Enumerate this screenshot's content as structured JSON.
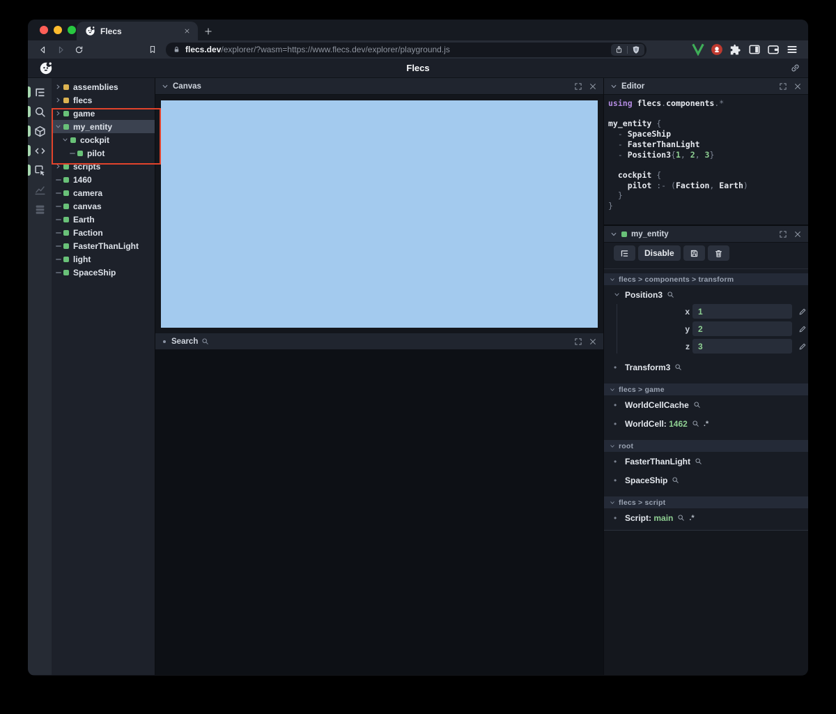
{
  "colors": {
    "accent_green": "#69c178",
    "accent_yellow": "#dcb351",
    "value_green": "#8ecf92",
    "code_keyword": "#b18adf",
    "canvas_blue": "#a3caee",
    "annotation_red": "#e2432b",
    "selection_gray": "#3b4250"
  },
  "browser": {
    "traffic_lights": [
      "close",
      "minimize",
      "zoom"
    ],
    "tab": {
      "title": "Flecs",
      "favicon": "flecs-logo",
      "close_icon": "close-icon"
    },
    "newtab_icon": "plus-icon",
    "nav": [
      "back-icon",
      "forward-icon",
      "reload-icon"
    ],
    "bookmark_icon": "bookmark-icon",
    "url": {
      "lock_icon": "lock-icon",
      "host": "flecs.dev",
      "path": "/explorer/?wasm=https://www.flecs.dev/explorer/playground.js",
      "share_icon": "share-icon",
      "shield_icon": "brave-shield-icon"
    },
    "extensions": [
      "v-extension-icon",
      "adblock-extension-icon",
      "puzzle-icon",
      "sidepanel-icon",
      "wallet-icon",
      "menu-icon"
    ]
  },
  "app": {
    "title": "Flecs",
    "logo": "flecs-logo",
    "link_icon": "link-icon",
    "iconbar": [
      {
        "name": "tree-view",
        "active": true
      },
      {
        "name": "search",
        "active": true
      },
      {
        "name": "cube",
        "active": true
      },
      {
        "name": "code",
        "active": true
      },
      {
        "name": "inspect",
        "active": true
      },
      {
        "name": "chart",
        "active": false
      },
      {
        "name": "rows",
        "active": false
      }
    ]
  },
  "tree": {
    "items": [
      {
        "label": "assemblies",
        "chevron": "right",
        "color": "yellow",
        "depth": 0
      },
      {
        "label": "flecs",
        "chevron": "right",
        "color": "yellow",
        "depth": 0
      },
      {
        "label": "game",
        "chevron": "right",
        "color": "green",
        "depth": 0
      },
      {
        "label": "my_entity",
        "chevron": "down",
        "color": "green",
        "depth": 0,
        "selected": true
      },
      {
        "label": "cockpit",
        "chevron": "down",
        "color": "green",
        "depth": 1
      },
      {
        "label": "pilot",
        "chevron": "leaf",
        "color": "green",
        "depth": 2
      },
      {
        "label": "scripts",
        "chevron": "right",
        "color": "green",
        "depth": 0
      },
      {
        "label": "1460",
        "chevron": "leaf",
        "color": "green",
        "depth": 0
      },
      {
        "label": "camera",
        "chevron": "leaf",
        "color": "green",
        "depth": 0
      },
      {
        "label": "canvas",
        "chevron": "leaf",
        "color": "green",
        "depth": 0
      },
      {
        "label": "Earth",
        "chevron": "leaf",
        "color": "green",
        "depth": 0
      },
      {
        "label": "Faction",
        "chevron": "leaf",
        "color": "green",
        "depth": 0
      },
      {
        "label": "FasterThanLight",
        "chevron": "leaf",
        "color": "green",
        "depth": 0
      },
      {
        "label": "light",
        "chevron": "leaf",
        "color": "green",
        "depth": 0
      },
      {
        "label": "SpaceShip",
        "chevron": "leaf",
        "color": "green",
        "depth": 0
      }
    ]
  },
  "panels": {
    "canvas": {
      "title": "Canvas"
    },
    "search": {
      "title": "Search"
    },
    "editor": {
      "title": "Editor",
      "code": [
        [
          {
            "t": "using ",
            "c": "kw"
          },
          {
            "t": "flecs",
            "c": "id"
          },
          {
            "t": ".",
            "c": "p"
          },
          {
            "t": "components",
            "c": "id"
          },
          {
            "t": ".*",
            "c": "p"
          }
        ],
        [],
        [
          {
            "t": "my_entity ",
            "c": "id"
          },
          {
            "t": "{",
            "c": "p"
          }
        ],
        [
          {
            "t": "  - ",
            "c": "p"
          },
          {
            "t": "SpaceShip",
            "c": "id"
          }
        ],
        [
          {
            "t": "  - ",
            "c": "p"
          },
          {
            "t": "FasterThanLight",
            "c": "id"
          }
        ],
        [
          {
            "t": "  - ",
            "c": "p"
          },
          {
            "t": "Position3",
            "c": "id"
          },
          {
            "t": "{",
            "c": "p"
          },
          {
            "t": "1",
            "c": "num"
          },
          {
            "t": ", ",
            "c": "p"
          },
          {
            "t": "2",
            "c": "num"
          },
          {
            "t": ", ",
            "c": "p"
          },
          {
            "t": "3",
            "c": "num"
          },
          {
            "t": "}",
            "c": "p"
          }
        ],
        [],
        [
          {
            "t": "  ",
            "c": "p"
          },
          {
            "t": "cockpit ",
            "c": "id"
          },
          {
            "t": "{",
            "c": "p"
          }
        ],
        [
          {
            "t": "    ",
            "c": "p"
          },
          {
            "t": "pilot ",
            "c": "id"
          },
          {
            "t": ":- (",
            "c": "p"
          },
          {
            "t": "Faction",
            "c": "id"
          },
          {
            "t": ", ",
            "c": "p"
          },
          {
            "t": "Earth",
            "c": "id"
          },
          {
            "t": ")",
            "c": "p"
          }
        ],
        [
          {
            "t": "  }",
            "c": "p"
          }
        ],
        [
          {
            "t": "}",
            "c": "p"
          }
        ]
      ]
    },
    "inspector": {
      "title": "my_entity",
      "toolbar": [
        {
          "icon": "filter-tree-icon",
          "name": "tree-filter"
        },
        {
          "label": "Disable",
          "name": "disable"
        },
        {
          "icon": "save-icon",
          "name": "save"
        },
        {
          "icon": "trash-icon",
          "name": "delete"
        }
      ],
      "sections": [
        {
          "header": "flecs > components > transform",
          "items": [
            {
              "kind": "expanded",
              "name": "Position3",
              "fields": [
                {
                  "label": "x",
                  "value": "1"
                },
                {
                  "label": "y",
                  "value": "2"
                },
                {
                  "label": "z",
                  "value": "3"
                }
              ]
            },
            {
              "kind": "plain",
              "name": "Transform3"
            }
          ]
        },
        {
          "header": "flecs > game",
          "items": [
            {
              "kind": "plain",
              "name": "WorldCellCache"
            },
            {
              "kind": "value",
              "name": "WorldCell",
              "value": "1462",
              "suffix": ".*"
            }
          ]
        },
        {
          "header": "root",
          "items": [
            {
              "kind": "plain",
              "name": "FasterThanLight"
            },
            {
              "kind": "plain",
              "name": "SpaceShip"
            }
          ]
        },
        {
          "header": "flecs > script",
          "items": [
            {
              "kind": "value",
              "name": "Script",
              "value": "main",
              "suffix": ".*"
            }
          ]
        }
      ]
    }
  }
}
